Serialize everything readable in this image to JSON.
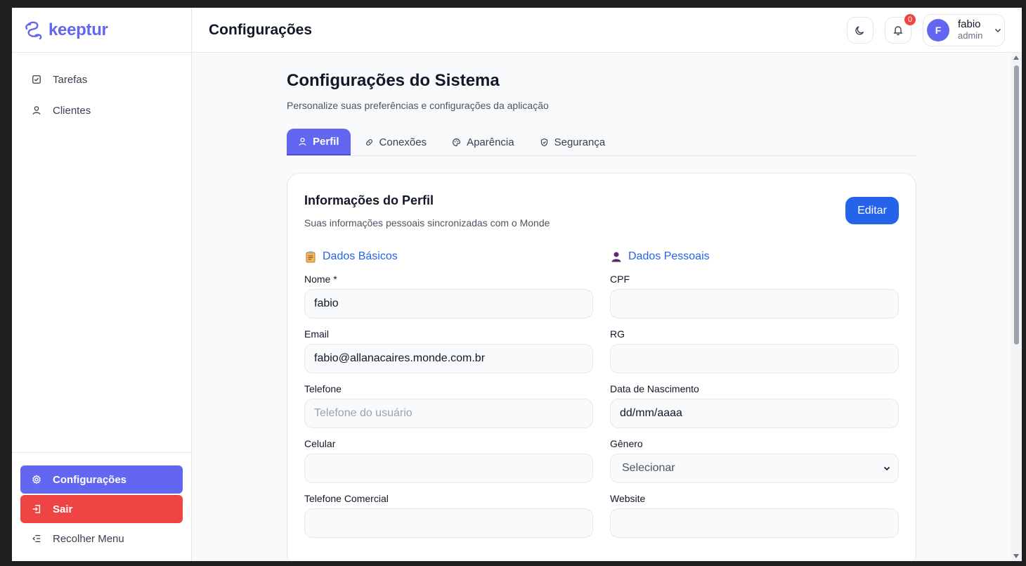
{
  "app": {
    "logo_text": "keeptur"
  },
  "sidebar": {
    "items": [
      {
        "label": "Tarefas",
        "icon": "square-check-icon"
      },
      {
        "label": "Clientes",
        "icon": "user-icon"
      }
    ],
    "bottom": {
      "settings_label": "Configurações",
      "logout_label": "Sair",
      "collapse_label": "Recolher Menu"
    }
  },
  "header": {
    "title": "Configurações",
    "notification_count": "0",
    "user_initial": "F",
    "user_name": "fabio",
    "user_role": "admin"
  },
  "page": {
    "title": "Configurações do Sistema",
    "subtitle": "Personalize suas preferências e configurações da aplicação",
    "tabs": [
      {
        "label": "Perfil",
        "icon": "user-icon",
        "active": true
      },
      {
        "label": "Conexões",
        "icon": "link-icon",
        "active": false
      },
      {
        "label": "Aparência",
        "icon": "palette-icon",
        "active": false
      },
      {
        "label": "Segurança",
        "icon": "shield-check-icon",
        "active": false
      }
    ]
  },
  "profile_card": {
    "title": "Informações do Perfil",
    "subtitle": "Suas informações pessoais sincronizadas com o Monde",
    "edit_label": "Editar",
    "basic": {
      "heading": "Dados Básicos",
      "fields": [
        {
          "label": "Nome *",
          "value": "fabio",
          "placeholder": ""
        },
        {
          "label": "Email",
          "value": "fabio@allanacaires.monde.com.br",
          "placeholder": ""
        },
        {
          "label": "Telefone",
          "value": "",
          "placeholder": "Telefone do usuário"
        },
        {
          "label": "Celular",
          "value": "",
          "placeholder": ""
        },
        {
          "label": "Telefone Comercial",
          "value": "",
          "placeholder": ""
        }
      ]
    },
    "personal": {
      "heading": "Dados Pessoais",
      "fields": [
        {
          "label": "CPF",
          "value": ""
        },
        {
          "label": "RG",
          "value": ""
        },
        {
          "label": "Data de Nascimento",
          "value": "dd/mm/aaaa"
        },
        {
          "label": "Gênero",
          "value": "Selecionar"
        },
        {
          "label": "Website",
          "value": ""
        }
      ]
    }
  },
  "colors": {
    "accent": "#6366f1",
    "primary_button": "#2563eb",
    "danger": "#ef4444"
  }
}
